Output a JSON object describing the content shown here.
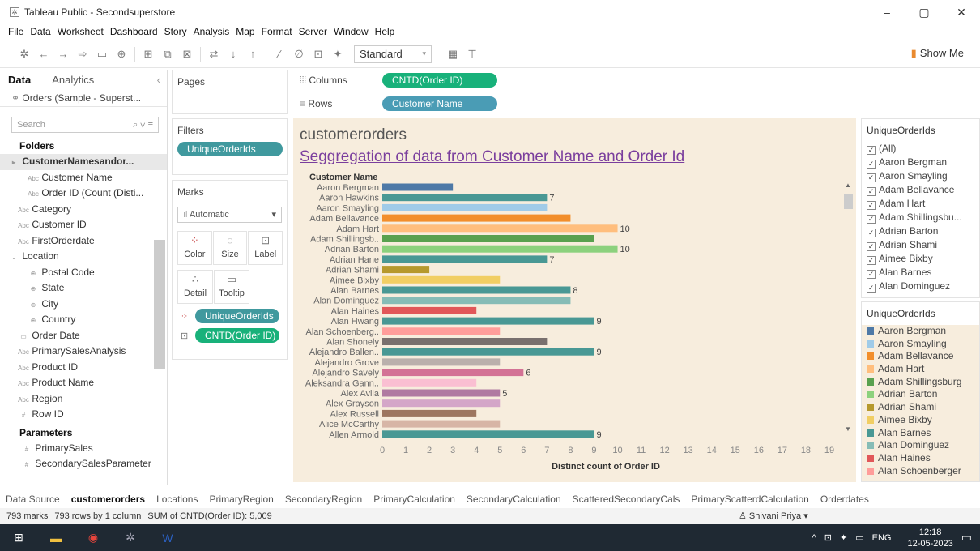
{
  "window": {
    "title": "Tableau Public - Secondsuperstore",
    "controls": [
      "–",
      "▢",
      "✕"
    ]
  },
  "menu": [
    "File",
    "Data",
    "Worksheet",
    "Dashboard",
    "Story",
    "Analysis",
    "Map",
    "Format",
    "Server",
    "Window",
    "Help"
  ],
  "toolbar": {
    "fit_select": "Standard",
    "show_me": "Show Me"
  },
  "data_pane": {
    "tab_data": "Data",
    "tab_analytics": "Analytics",
    "source": "Orders (Sample - Superst...",
    "search_placeholder": "Search",
    "folders_heading": "Folders",
    "parameters_heading": "Parameters",
    "items": [
      {
        "label": "CustomerNamesandor...",
        "icon": "▸",
        "indent": 0,
        "selected": true
      },
      {
        "label": "Customer Name",
        "icon": "Abc",
        "indent": 2
      },
      {
        "label": "Order ID (Count (Disti...",
        "icon": "Abc",
        "indent": 2
      },
      {
        "label": "Category",
        "icon": "Abc",
        "indent": 1
      },
      {
        "label": "Customer ID",
        "icon": "Abc",
        "indent": 1
      },
      {
        "label": "FirstOrderdate",
        "icon": "Abc",
        "indent": 1
      },
      {
        "label": "Location",
        "icon": "⌄",
        "indent": 0
      },
      {
        "label": "Postal Code",
        "icon": "⊕",
        "indent": 2
      },
      {
        "label": "State",
        "icon": "⊕",
        "indent": 2
      },
      {
        "label": "City",
        "icon": "⊕",
        "indent": 2
      },
      {
        "label": "Country",
        "icon": "⊕",
        "indent": 2
      },
      {
        "label": "Order Date",
        "icon": "▭",
        "indent": 1
      },
      {
        "label": "PrimarySalesAnalysis",
        "icon": "Abc",
        "indent": 1
      },
      {
        "label": "Product ID",
        "icon": "Abc",
        "indent": 1
      },
      {
        "label": "Product Name",
        "icon": "Abc",
        "indent": 1
      },
      {
        "label": "Region",
        "icon": "Abc",
        "indent": 1
      },
      {
        "label": "Row ID",
        "icon": "#",
        "indent": 1
      }
    ],
    "parameters": [
      "PrimarySales",
      "SecondarySalesParameter"
    ]
  },
  "shelves": {
    "pages": "Pages",
    "filters": "Filters",
    "filter_pill": "UniqueOrderIds",
    "marks": "Marks",
    "mark_type": "Automatic",
    "mark_buttons": [
      "Color",
      "Size",
      "Label",
      "Detail",
      "Tooltip"
    ],
    "mark_pills": [
      "UniqueOrderIds",
      "CNTD(Order ID)"
    ],
    "columns_label": "Columns",
    "columns_pill": "CNTD(Order ID)",
    "rows_label": "Rows",
    "rows_pill": "Customer Name"
  },
  "viz": {
    "title": "customerorders",
    "subtitle": "Seggregation of data from Customer Name and Order Id"
  },
  "chart_data": {
    "type": "bar",
    "orientation": "horizontal",
    "ylabel": "Customer Name",
    "xlabel": "Distinct count of Order ID",
    "xlim": [
      0,
      19
    ],
    "xticks": [
      0,
      1,
      2,
      3,
      4,
      5,
      6,
      7,
      8,
      9,
      10,
      11,
      12,
      13,
      14,
      15,
      16,
      17,
      18,
      19
    ],
    "categories": [
      "Aaron Bergman",
      "Aaron Hawkins",
      "Aaron Smayling",
      "Adam Bellavance",
      "Adam Hart",
      "Adam Shillingsb..",
      "Adrian Barton",
      "Adrian Hane",
      "Adrian Shami",
      "Aimee Bixby",
      "Alan Barnes",
      "Alan Dominguez",
      "Alan Haines",
      "Alan Hwang",
      "Alan Schoenberg..",
      "Alan Shonely",
      "Alejandro Ballen..",
      "Alejandro Grove",
      "Alejandro Savely",
      "Aleksandra Gann..",
      "Alex Avila",
      "Alex Grayson",
      "Alex Russell",
      "Alice McCarthy",
      "Allen Armold"
    ],
    "values": [
      3,
      7,
      7,
      8,
      10,
      9,
      10,
      7,
      2,
      5,
      8,
      8,
      4,
      9,
      5,
      7,
      9,
      5,
      6,
      4,
      5,
      5,
      4,
      5,
      9
    ],
    "data_labels": [
      "",
      "7",
      "",
      "",
      "10",
      "",
      "10",
      "7",
      "",
      "",
      "8",
      "",
      "",
      "9",
      "",
      "",
      "9",
      "",
      "6",
      "",
      "5",
      "",
      "",
      "",
      "9"
    ],
    "colors": [
      "#4e79a7",
      "#499894",
      "#a0cbe8",
      "#f28e2b",
      "#ffbe7d",
      "#59a14f",
      "#8cd17d",
      "#499894",
      "#b6992d",
      "#f1ce63",
      "#499894",
      "#86bcb6",
      "#e15759",
      "#499894",
      "#ff9d9a",
      "#79706e",
      "#499894",
      "#bab0ac",
      "#d37295",
      "#fabfd2",
      "#b07aa1",
      "#d4a6c8",
      "#9d7660",
      "#d7b5a6",
      "#499894"
    ],
    "grid": false
  },
  "filter_card": {
    "title": "UniqueOrderIds",
    "items": [
      "(All)",
      "Aaron Bergman",
      "Aaron Smayling",
      "Adam Bellavance",
      "Adam Hart",
      "Adam Shillingsbu...",
      "Adrian Barton",
      "Adrian Shami",
      "Aimee Bixby",
      "Alan Barnes",
      "Alan Dominguez"
    ]
  },
  "legend": {
    "title": "UniqueOrderIds",
    "items": [
      {
        "label": "Aaron Bergman",
        "color": "#4e79a7"
      },
      {
        "label": "Aaron Smayling",
        "color": "#a0cbe8"
      },
      {
        "label": "Adam Bellavance",
        "color": "#f28e2b"
      },
      {
        "label": "Adam Hart",
        "color": "#ffbe7d"
      },
      {
        "label": "Adam Shillingsburg",
        "color": "#59a14f"
      },
      {
        "label": "Adrian Barton",
        "color": "#8cd17d"
      },
      {
        "label": "Adrian Shami",
        "color": "#b6992d"
      },
      {
        "label": "Aimee Bixby",
        "color": "#f1ce63"
      },
      {
        "label": "Alan Barnes",
        "color": "#499894"
      },
      {
        "label": "Alan Dominguez",
        "color": "#86bcb6"
      },
      {
        "label": "Alan Haines",
        "color": "#e15759"
      },
      {
        "label": "Alan Schoenberger",
        "color": "#ff9d9a"
      }
    ]
  },
  "sheet_tabs": [
    "Data Source",
    "customerorders",
    "Locations",
    "PrimaryRegion",
    "SecondaryRegion",
    "PrimaryCalculation",
    "SecondaryCalculation",
    "ScatteredSecondaryCals",
    "PrimaryScatterdCalculation",
    "Orderdates"
  ],
  "active_tab": "customerorders",
  "status": {
    "marks": "793 marks",
    "rows": "793 rows by 1 column",
    "sum": "SUM of CNTD(Order ID): 5,009",
    "user": "Shivani Priya"
  },
  "taskbar": {
    "lang": "ENG",
    "time": "12:18",
    "date": "12-05-2023"
  }
}
